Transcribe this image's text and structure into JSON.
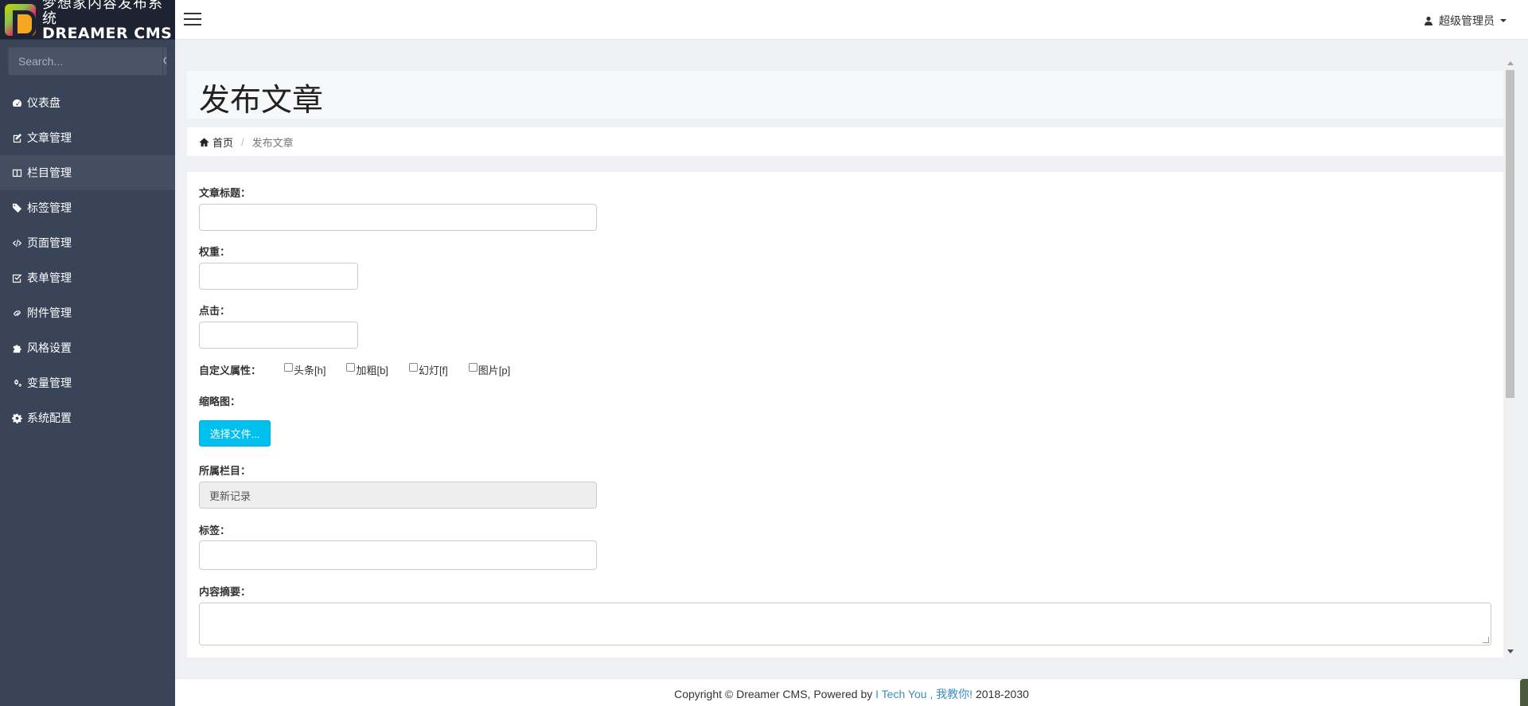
{
  "brand": {
    "name_cn": "梦想家内容发布系统",
    "name_en": "DREAMER CMS"
  },
  "search": {
    "placeholder": "Search..."
  },
  "sidebar": {
    "items": [
      {
        "label": "仪表盘",
        "icon": "dashboard-icon"
      },
      {
        "label": "文章管理",
        "icon": "edit-icon"
      },
      {
        "label": "栏目管理",
        "icon": "columns-icon"
      },
      {
        "label": "标签管理",
        "icon": "tags-icon"
      },
      {
        "label": "页面管理",
        "icon": "code-icon"
      },
      {
        "label": "表单管理",
        "icon": "check-square-icon"
      },
      {
        "label": "附件管理",
        "icon": "link-icon"
      },
      {
        "label": "风格设置",
        "icon": "puzzle-icon"
      },
      {
        "label": "变量管理",
        "icon": "gears-icon"
      },
      {
        "label": "系统配置",
        "icon": "gear-icon"
      }
    ],
    "active_index": 2
  },
  "header": {
    "user_label": "超级管理员"
  },
  "page": {
    "title": "发布文章",
    "breadcrumb": {
      "home": "首页",
      "current": "发布文章"
    }
  },
  "form": {
    "title_label": "文章标题：",
    "weight_label": "权重：",
    "clicks_label": "点击：",
    "attrs_label": "自定义属性：",
    "attrs": [
      "头条[h]",
      "加粗[b]",
      "幻灯[f]",
      "图片[p]"
    ],
    "thumb_label": "缩略图：",
    "file_button": "选择文件...",
    "category_label": "所属栏目：",
    "category_value": "更新记录",
    "tags_label": "标签：",
    "summary_label": "内容摘要："
  },
  "footer": {
    "prefix": "Copyright © Dreamer CMS, Powered by ",
    "link": "I Tech You , 我教你!",
    "suffix": " 2018-2030"
  }
}
